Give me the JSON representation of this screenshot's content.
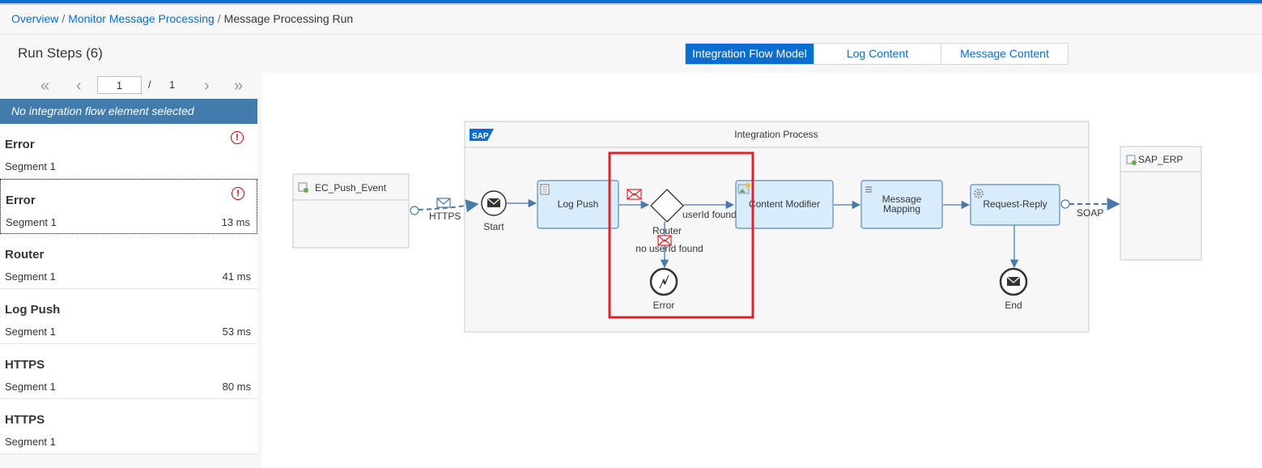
{
  "breadcrumb": {
    "items": [
      "Overview",
      "Monitor Message Processing"
    ],
    "current": "Message Processing Run",
    "separator": "/"
  },
  "run_steps": {
    "title": "Run Steps (6)"
  },
  "tabs": [
    {
      "label": "Integration Flow Model",
      "active": true
    },
    {
      "label": "Log Content",
      "active": false
    },
    {
      "label": "Message Content",
      "active": false
    }
  ],
  "pager": {
    "current": "1",
    "separator": "/",
    "total": "1",
    "icons": [
      "first-page-icon",
      "prev-page-icon",
      "next-page-icon",
      "last-page-icon"
    ]
  },
  "selection_banner": "No integration flow element selected",
  "steps": [
    {
      "name": "Error",
      "segment": "Segment 1",
      "duration": "",
      "error": true
    },
    {
      "name": "Error",
      "segment": "Segment 1",
      "duration": "13 ms",
      "error": true
    },
    {
      "name": "Router",
      "segment": "Segment 1",
      "duration": "41 ms",
      "error": false
    },
    {
      "name": "Log Push",
      "segment": "Segment 1",
      "duration": "53 ms",
      "error": false
    },
    {
      "name": "HTTPS",
      "segment": "Segment 1",
      "duration": "80 ms",
      "error": false
    },
    {
      "name": "HTTPS",
      "segment": "Segment 1",
      "duration": "",
      "error": false
    }
  ],
  "diagram": {
    "pool_title": "Integration Process",
    "logo_text": "SAP",
    "sender": "EC_Push_Event",
    "receiver": "SAP_ERP",
    "sender_channel": "HTTPS",
    "receiver_channel": "SOAP",
    "start_event": "Start",
    "end_event": "End",
    "error_event": "Error",
    "tasks": {
      "log_push": "Log Push",
      "content_modifier": "Content Modifier",
      "message_mapping_line1": "Message",
      "message_mapping_line2": "Mapping",
      "request_reply": "Request-Reply"
    },
    "router": "Router",
    "route_found": "userId found",
    "route_not_found": "no userId found"
  },
  "colors": {
    "accent": "#0a6ed1",
    "banner": "#427cac",
    "task_fill": "#d9ecfc",
    "task_stroke": "#5d8ab5",
    "highlight": "#d9262e",
    "error": "#bb0000"
  }
}
